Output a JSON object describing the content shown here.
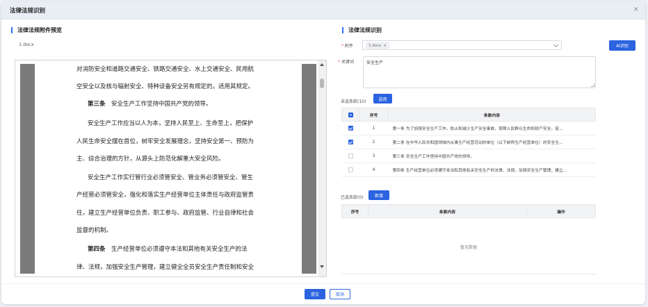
{
  "dialog": {
    "title": "法律法规识别",
    "close": "×"
  },
  "left": {
    "section_title": "法律法规附件预览",
    "filename": "1.docx",
    "doc_lines": [
      {
        "bold": "",
        "text": "对消防安全和道路交通安全、铁路交通安全、水上交通安全、民用航"
      },
      {
        "bold": "",
        "text": "空安全以及核与辐射安全、特种设备安全另有规定的，适用其规定。"
      },
      {
        "bold": "第三条",
        "text": "　安全生产工作坚持中国共产党的领导。"
      },
      {
        "bold": "",
        "text": "安全生产工作应当以人为本，坚持人民至上、生命至上，把保护"
      },
      {
        "bold": "",
        "text": "人民生命安全摆在首位，树牢安全发展理念，坚持安全第一、预防为"
      },
      {
        "bold": "",
        "text": "主、综合治理的方针，从源头上防范化解重大安全风险。"
      },
      {
        "bold": "",
        "text": "安全生产工作实行管行业必须管安全、管业务必须管安全、管生"
      },
      {
        "bold": "",
        "text": "产经营必须管安全，强化和落实生产经营单位主体责任与政府监管责"
      },
      {
        "bold": "",
        "text": "任，建立生产经营单位负责、职工参与、政府监管、行业自律和社会"
      },
      {
        "bold": "",
        "text": "监督的机制。"
      },
      {
        "bold": "第四条",
        "text": "　生产经营单位必须遵守本法和其他有关安全生产的法"
      },
      {
        "bold": "",
        "text": "律、法规，加强安全生产管理，建立健全全员安全生产责任制和安全"
      }
    ]
  },
  "right": {
    "section_title": "法律法规识别",
    "attachment_label": "附件",
    "attachment_tag": "1.docx",
    "tag_close": "×",
    "ai_button": "AI识别",
    "keyword_label": "关键词",
    "keyword_value": "安全生产",
    "pending_label": "未选条款(10)",
    "apply_button": "选用",
    "pending_table": {
      "headers": [
        "序号",
        "条款内容"
      ],
      "rows": [
        {
          "checked": true,
          "index": "1",
          "content": "第一条 为了加强安全生产工作，防止和减少生产安全事故，保障人民群众生命和财产安全，促..."
        },
        {
          "checked": true,
          "index": "2",
          "content": "第二条 在中华人民共和国领域内从事生产经营活动的单位（以下统称生产经营单位）的安全生..."
        },
        {
          "checked": false,
          "index": "3",
          "content": "第三条 安全生产工作坚持中国共产党的领导。"
        },
        {
          "checked": false,
          "index": "4",
          "content": "第四条 生产经营单位必须遵守本法和其他有关安全生产的法律、法规，加强安全生产管理，建立..."
        }
      ]
    },
    "selected_label": "已选条款(0)",
    "add_button": "新增",
    "selected_table": {
      "headers": [
        "序号",
        "条款内容",
        "操作"
      ],
      "empty_text": "暂无数据"
    }
  },
  "footer": {
    "submit": "提交",
    "cancel": "取消"
  },
  "colors": {
    "primary": "#2b63e0",
    "header_bg": "#e9edf4",
    "required": "#e55555"
  }
}
